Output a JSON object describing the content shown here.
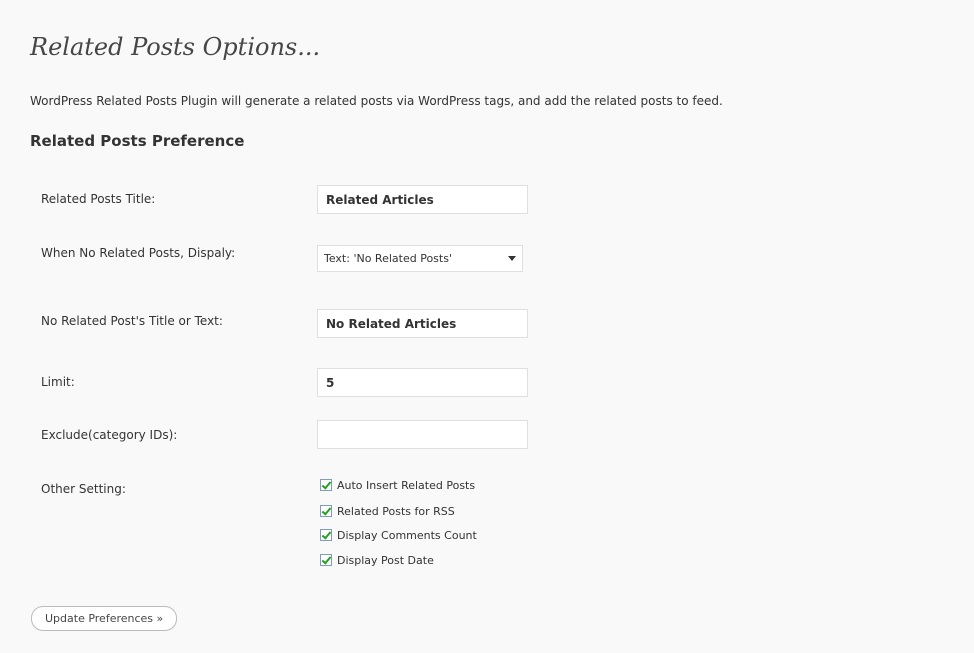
{
  "page": {
    "title": "Related Posts Options...",
    "intro": "WordPress Related Posts Plugin will generate a related posts via WordPress tags, and add the related posts to feed.",
    "section_heading": "Related Posts Preference"
  },
  "form": {
    "related_title": {
      "label": "Related Posts Title:",
      "value": "Related Articles"
    },
    "no_related_display": {
      "label": "When No Related Posts, Dispaly:",
      "selected": "Text: 'No Related Posts'"
    },
    "no_related_text": {
      "label": "No Related Post's Title or Text:",
      "value": "No Related Articles"
    },
    "limit": {
      "label": "Limit:",
      "value": "5"
    },
    "exclude": {
      "label": "Exclude(category IDs):",
      "value": ""
    },
    "other": {
      "label": "Other Setting:",
      "options": [
        {
          "label": "Auto Insert Related Posts",
          "checked": true
        },
        {
          "label": "Related Posts for RSS",
          "checked": true
        },
        {
          "label": "Display Comments Count",
          "checked": true
        },
        {
          "label": "Display Post Date",
          "checked": true
        }
      ]
    }
  },
  "actions": {
    "update_label": "Update Preferences »"
  },
  "icons": {
    "select_arrow": "chevron-down-icon",
    "checkbox": "checkmark-icon"
  }
}
